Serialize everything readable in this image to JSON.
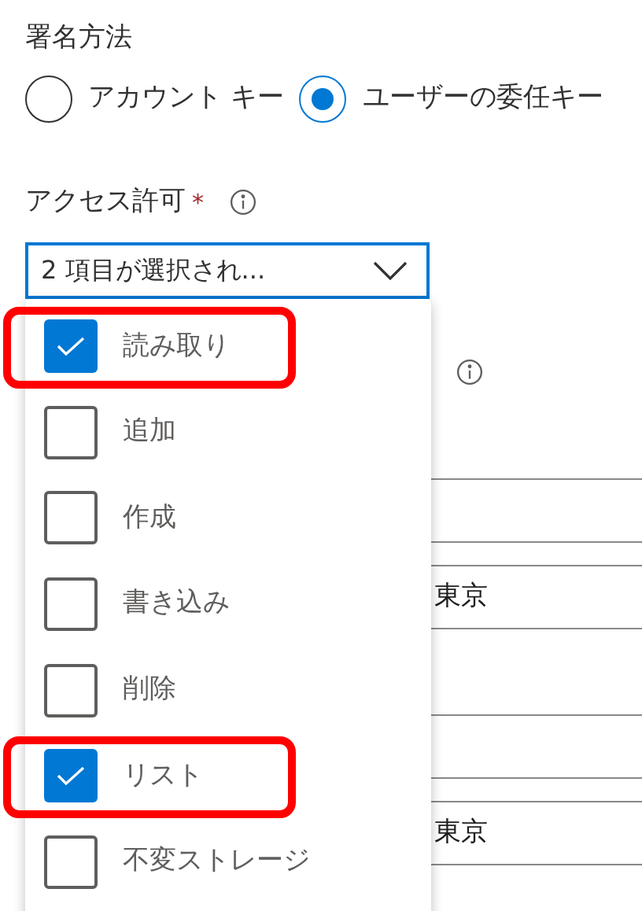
{
  "signing_method": {
    "label": "署名方法",
    "options": [
      {
        "label": "アカウント キー",
        "selected": false
      },
      {
        "label": "ユーザーの委任キー",
        "selected": true
      }
    ]
  },
  "permissions": {
    "label": "アクセス許可",
    "required_mark": "*",
    "value": "2 項目が選択され...",
    "expanded": true,
    "options": [
      {
        "label": "読み取り",
        "checked": true,
        "highlighted": true
      },
      {
        "label": "追加",
        "checked": false,
        "highlighted": false
      },
      {
        "label": "作成",
        "checked": false,
        "highlighted": false
      },
      {
        "label": "書き込み",
        "checked": false,
        "highlighted": false
      },
      {
        "label": "削除",
        "checked": false,
        "highlighted": false
      },
      {
        "label": "リスト",
        "checked": true,
        "highlighted": true
      },
      {
        "label": "不変ストレージ",
        "checked": false,
        "highlighted": false
      }
    ]
  },
  "background_fields": [
    {
      "value": "東京"
    },
    {
      "value": "東京"
    }
  ]
}
